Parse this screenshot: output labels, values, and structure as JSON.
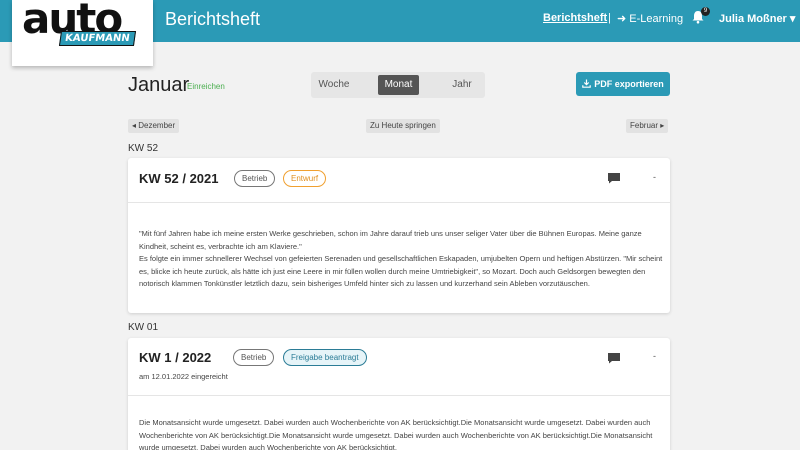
{
  "header": {
    "logo_top": "auto",
    "logo_bottom": "KAUFMANN",
    "title": "Berichtsheft",
    "nav_active": "Berichtsheft",
    "nav_sep": "|",
    "nav_elearning": "E-Learning",
    "bell_count": "9",
    "user": "Julia Moßner",
    "brand_color": "#2b9ab6"
  },
  "toolbar": {
    "month": "Januar",
    "einreichen": "Einreichen",
    "views": [
      "Woche",
      "Monat",
      "Jahr"
    ],
    "active_view": "Monat",
    "export_label": "PDF exportieren"
  },
  "pager": {
    "prev": "Dezember",
    "today": "Zu Heute springen",
    "next": "Februar"
  },
  "weeks": [
    {
      "kw": "KW 52",
      "title": "KW 52 / 2021",
      "tag": "Betrieb",
      "status": "Entwurf",
      "collapse": "-",
      "text": "\"Mit fünf Jahren habe ich meine ersten Werke geschrieben, schon im Jahre darauf trieb uns unser seliger Vater über die Bühnen Europas. Meine ganze Kindheit, scheint es, verbrachte ich am Klaviere.\"\nEs folgte ein immer schnellerer Wechsel von gefeierten Serenaden und gesellschaftlichen Eskapaden, umjubelten Opern und heftigen Abstürzen. \"Mir scheint es, blicke ich heute zurück, als hätte ich just eine Leere in mir füllen wollen durch meine Umtriebigkeit\", so Mozart. Doch auch Geldsorgen bewegten den notorisch klammen Tonkünstler letztlich dazu, sein bisheriges Umfeld hinter sich zu lassen und kurzerhand sein Ableben vorzutäuschen."
    },
    {
      "kw": "KW 01",
      "title": "KW 1 / 2022",
      "tag": "Betrieb",
      "status": "Freigabe beantragt",
      "submitted": "am 12.01.2022 eingereicht",
      "collapse": "-",
      "text": "Die Monatsansicht wurde umgesetzt. Dabei wurden auch Wochenberichte von AK berücksichtigt.Die Monatsansicht wurde umgesetzt. Dabei wurden auch Wochenberichte von AK berücksichtigt.Die Monatsansicht wurde umgesetzt. Dabei wurden auch Wochenberichte von AK berücksichtigt.Die Monatsansicht wurde umgesetzt. Dabei wurden auch Wochenberichte von AK berücksichtigt."
    }
  ]
}
